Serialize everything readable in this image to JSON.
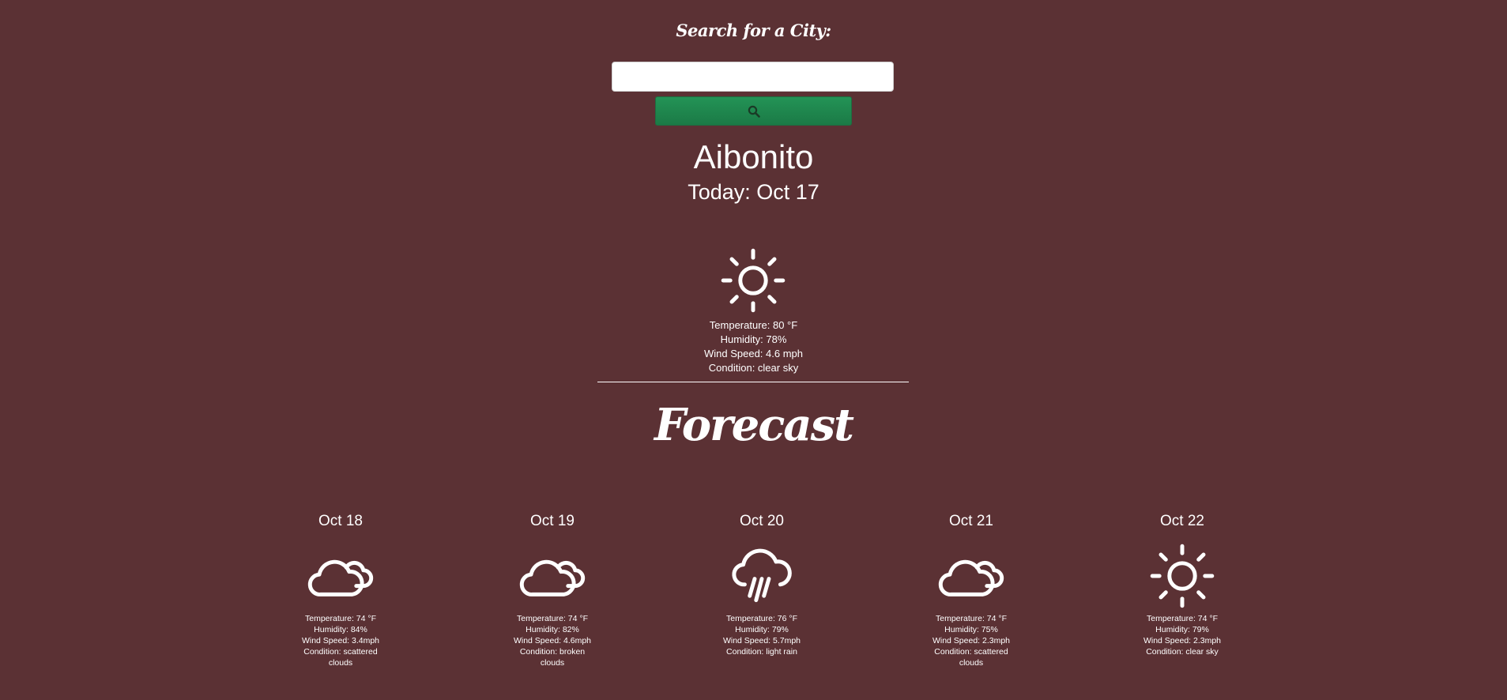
{
  "search": {
    "heading": "Search for a City:",
    "input_value": "",
    "placeholder": "",
    "button_icon": "search-icon"
  },
  "current": {
    "city": "Aibonito",
    "date_label": "Today: Oct 17",
    "icon": "sun-icon",
    "temperature": "Temperature: 80 °F",
    "humidity": "Humidity: 78%",
    "wind": "Wind Speed: 4.6 mph",
    "condition": "Condition: clear sky"
  },
  "forecast": {
    "heading": "Forecast",
    "days": [
      {
        "date": "Oct 18",
        "icon": "cloud-icon",
        "temperature": "Temperature: 74 °F",
        "humidity": "Humidity: 84%",
        "wind": "Wind Speed: 3.4mph",
        "condition": "Condition: scattered clouds"
      },
      {
        "date": "Oct 19",
        "icon": "cloud-icon",
        "temperature": "Temperature: 74 °F",
        "humidity": "Humidity: 82%",
        "wind": "Wind Speed: 4.6mph",
        "condition": "Condition: broken clouds"
      },
      {
        "date": "Oct 20",
        "icon": "rain-icon",
        "temperature": "Temperature: 76 °F",
        "humidity": "Humidity: 79%",
        "wind": "Wind Speed: 5.7mph",
        "condition": "Condition: light rain"
      },
      {
        "date": "Oct 21",
        "icon": "cloud-icon",
        "temperature": "Temperature: 74 °F",
        "humidity": "Humidity: 75%",
        "wind": "Wind Speed: 2.3mph",
        "condition": "Condition: scattered clouds"
      },
      {
        "date": "Oct 22",
        "icon": "sun-icon",
        "temperature": "Temperature: 74 °F",
        "humidity": "Humidity: 79%",
        "wind": "Wind Speed: 2.3mph",
        "condition": "Condition: clear sky"
      }
    ]
  },
  "colors": {
    "background": "#5b3134",
    "button": "#239356",
    "text": "#ffffff"
  }
}
